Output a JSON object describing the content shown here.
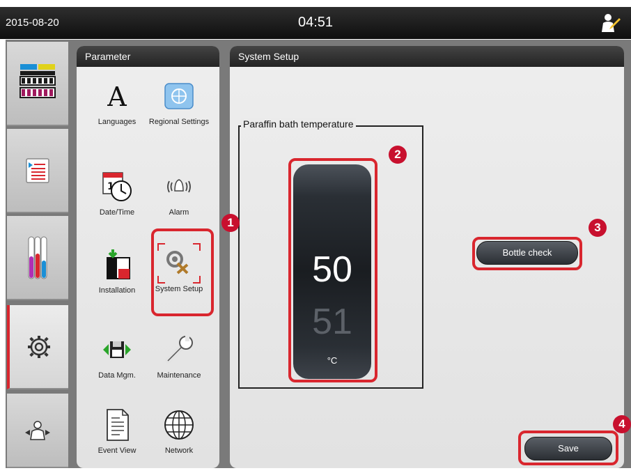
{
  "statusbar": {
    "date": "2015-08-20",
    "time": "04:51",
    "user_icon": "user-supervisor-icon"
  },
  "nav": {
    "items": [
      {
        "name": "station-status",
        "icon": "station-overview-icon",
        "active": false
      },
      {
        "name": "program",
        "icon": "program-list-icon",
        "active": false
      },
      {
        "name": "reagents",
        "icon": "reagent-tubes-icon",
        "active": false
      },
      {
        "name": "settings",
        "icon": "gear-icon",
        "active": true
      },
      {
        "name": "user",
        "icon": "user-switch-icon",
        "active": false
      }
    ]
  },
  "parameter": {
    "title": "Parameter",
    "items": [
      {
        "label": "Languages",
        "icon": "letter-a-icon"
      },
      {
        "label": "Regional Settings",
        "icon": "globe-settings-icon"
      },
      {
        "label": "Date/Time",
        "icon": "calendar-clock-icon"
      },
      {
        "label": "Alarm",
        "icon": "bell-icon"
      },
      {
        "label": "Installation",
        "icon": "installation-icon"
      },
      {
        "label": "System Setup",
        "icon": "system-setup-icon"
      },
      {
        "label": "Data Mgm.",
        "icon": "floppy-icon"
      },
      {
        "label": "Maintenance",
        "icon": "wrench-icon"
      },
      {
        "label": "Event View",
        "icon": "document-icon"
      },
      {
        "label": "Network",
        "icon": "network-globe-icon"
      }
    ]
  },
  "system_setup": {
    "title": "System Setup",
    "paraffin_group_label": "Paraffin bath temperature",
    "temperature_value": "50",
    "temperature_next": "51",
    "temperature_unit": "°C",
    "bottle_check_label": "Bottle check",
    "save_label": "Save"
  },
  "callouts": [
    "1",
    "2",
    "3",
    "4"
  ],
  "colors": {
    "accent_red": "#d9262e",
    "badge_red": "#c8102e",
    "header_dark": "#232323"
  }
}
